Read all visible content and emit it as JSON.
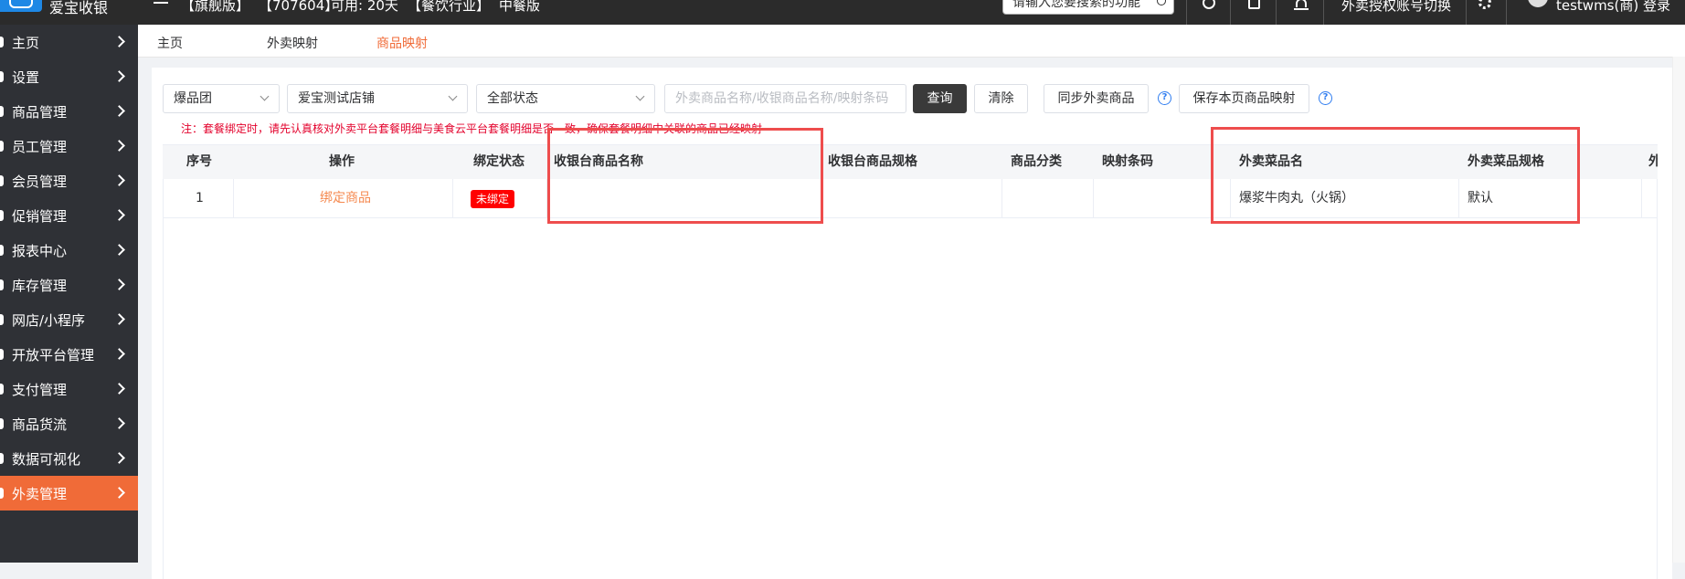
{
  "topbar": {
    "brand": "爱宝收银",
    "edition": "【旗舰版】",
    "store_id": "【707604】",
    "quota": "可用: 20天",
    "industry": "【餐饮行业】",
    "plan": "中餐版",
    "search_placeholder": "请输入您要搜索的功能",
    "account_bind": "外卖授权账号切换",
    "user": "testwms(商) 登录"
  },
  "sidebar": {
    "items": [
      {
        "label": "主页"
      },
      {
        "label": "设置"
      },
      {
        "label": "商品管理"
      },
      {
        "label": "员工管理"
      },
      {
        "label": "会员管理"
      },
      {
        "label": "促销管理"
      },
      {
        "label": "报表中心"
      },
      {
        "label": "库存管理"
      },
      {
        "label": "网店/小程序"
      },
      {
        "label": "开放平台管理"
      },
      {
        "label": "支付管理"
      },
      {
        "label": "商品货流"
      },
      {
        "label": "数据可视化"
      },
      {
        "label": "外卖管理"
      }
    ],
    "active_index": 13
  },
  "tabs": [
    "主页",
    "外卖映射",
    "商品映射"
  ],
  "filters": {
    "platform": "爆品团",
    "store": "爱宝测试店铺",
    "status": "全部状态",
    "search_placeholder": "外卖商品名称/收银商品名称/映射条码",
    "query_btn": "查询",
    "clear_btn": "清除",
    "sync_btn": "同步外卖商品",
    "save_btn": "保存本页商品映射"
  },
  "note": "注：套餐绑定时，请先认真核对外卖平台套餐明细与美食云平台套餐明细是否一致，确保套餐明细中关联的商品已经映射",
  "table": {
    "columns": [
      "序号",
      "操作",
      "绑定状态",
      "收银台商品名称",
      "收银台商品规格",
      "商品分类",
      "映射条码",
      "外卖菜品名",
      "外卖菜品规格",
      "外"
    ],
    "rows": [
      {
        "index": "1",
        "action": "绑定商品",
        "status": "未绑定",
        "pos_name": "",
        "pos_spec": "",
        "category": "",
        "barcode": "",
        "takeout_name": "爆浆牛肉丸（火锅）",
        "takeout_spec": "默认"
      }
    ]
  },
  "colors": {
    "accent": "#f06b38",
    "sidebar_bg": "#2f3136",
    "topbar_bg": "#2b2b2b",
    "unbound_tag": "#ff0000",
    "highlight": "#ee4d4d",
    "help": "#2f7df0"
  },
  "icons": [
    "logo-icon",
    "menu-icon",
    "search-icon",
    "help-circle-icon",
    "upload-icon",
    "bell-icon",
    "gear-icon",
    "avatar",
    "chevron-right-icon",
    "question-icon",
    "chevron-down-icon"
  ]
}
